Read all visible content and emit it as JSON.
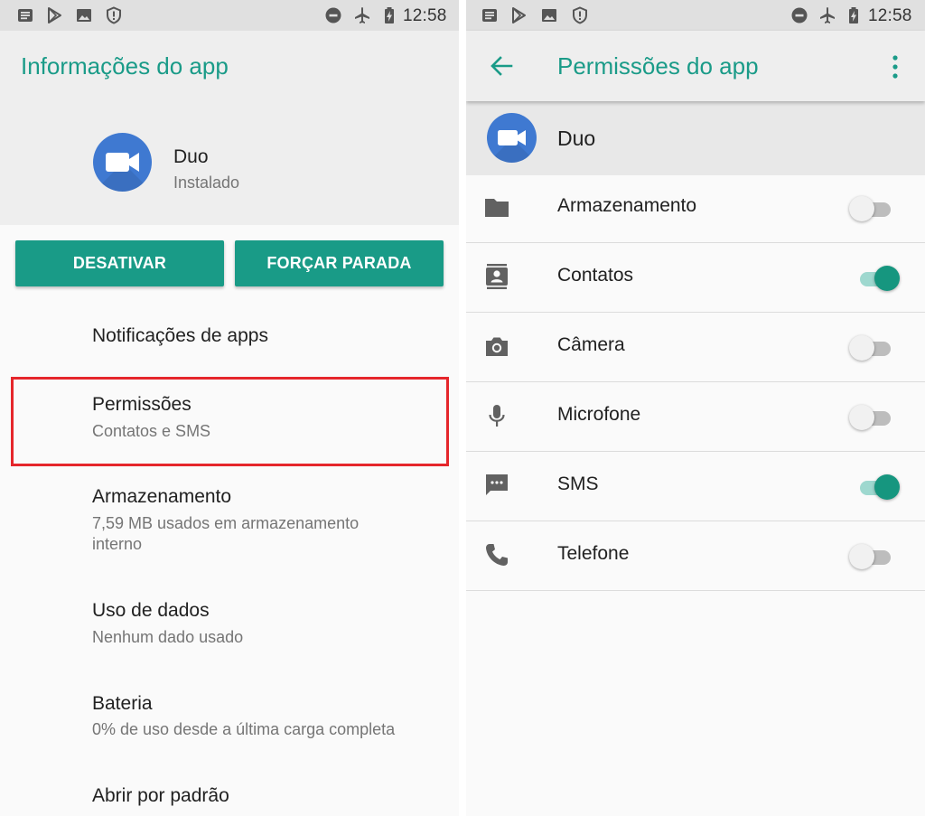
{
  "status_bar": {
    "time": "12:58",
    "left_icons": [
      "notification-message-icon",
      "play-store-icon",
      "image-icon",
      "shield-alert-icon"
    ],
    "right_icons": [
      "do-not-disturb-icon",
      "airplane-mode-icon",
      "battery-charging-icon"
    ]
  },
  "app_info": {
    "title": "Informações do app",
    "app_name": "Duo",
    "app_status": "Instalado",
    "buttons": {
      "disable": "DESATIVAR",
      "force_stop": "FORÇAR PARADA"
    },
    "items": [
      {
        "title": "Notificações de apps",
        "subtitle": ""
      },
      {
        "title": "Permissões",
        "subtitle": "Contatos e SMS"
      },
      {
        "title": "Armazenamento",
        "subtitle": "7,59 MB usados em armazenamento interno"
      },
      {
        "title": "Uso de dados",
        "subtitle": "Nenhum dado usado"
      },
      {
        "title": "Bateria",
        "subtitle": "0% de uso desde a última carga completa"
      },
      {
        "title": "Abrir por padrão",
        "subtitle": ""
      }
    ]
  },
  "permissions": {
    "title": "Permissões do app",
    "app_name": "Duo",
    "items": [
      {
        "label": "Armazenamento",
        "icon": "folder-icon",
        "enabled": false
      },
      {
        "label": "Contatos",
        "icon": "contacts-icon",
        "enabled": true
      },
      {
        "label": "Câmera",
        "icon": "camera-icon",
        "enabled": false
      },
      {
        "label": "Microfone",
        "icon": "microphone-icon",
        "enabled": false
      },
      {
        "label": "SMS",
        "icon": "sms-icon",
        "enabled": true
      },
      {
        "label": "Telefone",
        "icon": "phone-icon",
        "enabled": false
      }
    ]
  },
  "colors": {
    "accent": "#1a9b88",
    "button": "#199b87",
    "highlight_border": "#e5262b",
    "app_icon": "#3f79d1"
  }
}
